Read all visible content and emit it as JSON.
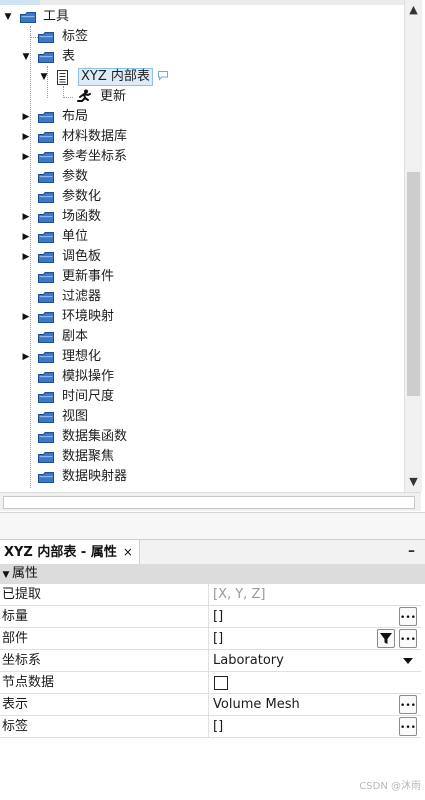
{
  "tree": {
    "root": "工具",
    "tags": "标签",
    "table": "表",
    "xyz_table": "XYZ 内部表",
    "update": "更新",
    "items": [
      "布局",
      "材料数据库",
      "参考坐标系",
      "参数",
      "参数化",
      "场函数",
      "单位",
      "调色板",
      "更新事件",
      "过滤器",
      "环境映射",
      "剧本",
      "理想化",
      "模拟操作",
      "时间尺度",
      "视图",
      "数据集函数",
      "数据聚焦",
      "数据映射器"
    ]
  },
  "properties": {
    "panel_title": "XYZ 内部表 - 属性",
    "close_glyph": "×",
    "minimize_glyph": "–",
    "section": "属性",
    "rows": [
      {
        "name": "已提取",
        "value": "[X, Y, Z]"
      },
      {
        "name": "标量",
        "value": "[]"
      },
      {
        "name": "部件",
        "value": "[]"
      },
      {
        "name": "坐标系",
        "value": "Laboratory"
      },
      {
        "name": "节点数据",
        "value": ""
      },
      {
        "name": "表示",
        "value": "Volume Mesh"
      },
      {
        "name": "标签",
        "value": "[]"
      }
    ]
  },
  "watermark": "CSDN @沐雨",
  "colors": {
    "folder": "#3b78c9",
    "selection_border": "#8ec2ea",
    "selection_fill": "#dcebf7",
    "section_bg": "#dcdcdc"
  }
}
